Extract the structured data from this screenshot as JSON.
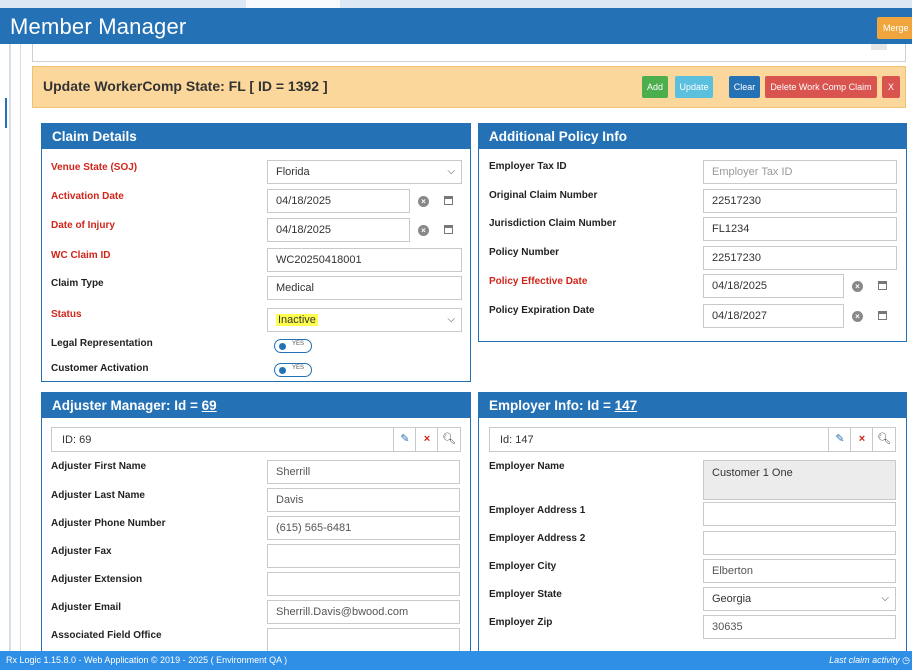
{
  "app": {
    "title": "Member Manager",
    "merge_label": "Merge"
  },
  "banner": {
    "title": "Update WorkerComp State: FL [ ID = 1392 ]",
    "buttons": {
      "add": "Add",
      "update": "Update",
      "clear": "Clear",
      "delete": "Delete Work Comp Claim",
      "close": "X"
    },
    "colors": {
      "add": "#4cae4c",
      "update": "#5bc0de",
      "clear": "#2471b5",
      "delete": "#d9534f",
      "bar": "#fbd79c"
    }
  },
  "claim": {
    "title": "Claim Details",
    "venue_label": "Venue State (SOJ)",
    "venue_value": "Florida",
    "activation_label": "Activation Date",
    "activation_value": "04/18/2025",
    "injury_label": "Date of Injury",
    "injury_value": "04/18/2025",
    "wcid_label": "WC Claim ID",
    "wcid_value": "WC20250418001",
    "type_label": "Claim Type",
    "type_value": "Medical",
    "status_label": "Status",
    "status_value": "Inactive",
    "legal_label": "Legal Representation",
    "legal_toggle": "YES",
    "customer_label": "Customer Activation",
    "customer_toggle": "YES"
  },
  "policy": {
    "title": "Additional Policy Info",
    "taxid_label": "Employer Tax ID",
    "taxid_placeholder": "Employer Tax ID",
    "orig_label": "Original Claim Number",
    "orig_value": "22517230",
    "juris_label": "Jurisdiction Claim Number",
    "juris_value": "FL1234",
    "policy_label": "Policy Number",
    "policy_value": "22517230",
    "eff_label": "Policy Effective Date",
    "eff_value": "04/18/2025",
    "exp_label": "Policy Expiration Date",
    "exp_value": "04/18/2027"
  },
  "adjuster": {
    "title_prefix": "Adjuster Manager: Id = ",
    "title_id": "69",
    "search_value": "ID: 69",
    "first_label": "Adjuster First Name",
    "first_value": "Sherrill",
    "last_label": "Adjuster Last Name",
    "last_value": "Davis",
    "phone_label": "Adjuster Phone Number",
    "phone_value": "(615) 565-6481",
    "fax_label": "Adjuster Fax",
    "ext_label": "Adjuster Extension",
    "email_label": "Adjuster Email",
    "email_value": "Sherrill.Davis@bwood.com",
    "office_label": "Associated Field Office"
  },
  "employer": {
    "title_prefix": "Employer Info: Id = ",
    "title_id": "147",
    "search_value": "Id: 147",
    "name_label": "Employer Name",
    "name_value": "Customer 1 One",
    "addr1_label": "Employer Address 1",
    "addr2_label": "Employer Address 2",
    "city_label": "Employer City",
    "city_value": "Elberton",
    "state_label": "Employer State",
    "state_value": "Georgia",
    "zip_label": "Employer Zip",
    "zip_value": "30635"
  },
  "footer": {
    "left": "Rx Logic 1.15.8.0 - Web Application © 2019 - 2025 ( Environment QA )",
    "right": "Last claim activity"
  },
  "colors": {
    "header": "#2471b5",
    "required_label": "#d0251b",
    "footer": "#2f8ee5",
    "highlight": "#ffff4d"
  }
}
